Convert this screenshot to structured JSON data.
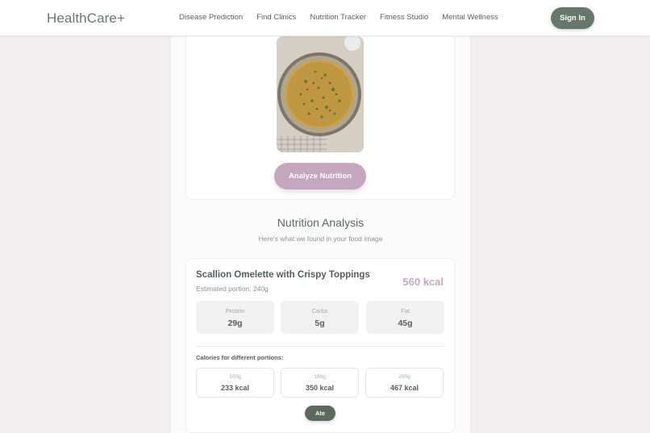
{
  "navbar": {
    "logo": "HealthCare+",
    "links": [
      "Disease Prediction",
      "Find Clinics",
      "Nutrition Tracker",
      "Fitness Studio",
      "Mental Wellness"
    ],
    "sign_in": "Sign In"
  },
  "upload": {
    "image_name": "food-photo",
    "analyze_label": "Analyze Nutrition"
  },
  "analysis": {
    "title": "Nutrition Analysis",
    "subtitle": "Here's what we found in your food image"
  },
  "result": {
    "food_name": "Scallion Omelette with Crispy Toppings",
    "portion": "Estimated portion: 240g",
    "calories": "560 kcal",
    "macros": [
      {
        "label": "Protein",
        "value": "29g"
      },
      {
        "label": "Carbs",
        "value": "5g"
      },
      {
        "label": "Fat",
        "value": "45g"
      }
    ],
    "portions_title": "Calories for different portions:",
    "portions": [
      {
        "size": "100g",
        "kcal": "233 kcal"
      },
      {
        "size": "150g",
        "kcal": "350 kcal"
      },
      {
        "size": "200g",
        "kcal": "467 kcal"
      }
    ],
    "ate_label": "Ate"
  },
  "colors": {
    "accent_primary": "#66786c",
    "accent_secondary": "#c4a7be",
    "background": "#f1eff0"
  }
}
